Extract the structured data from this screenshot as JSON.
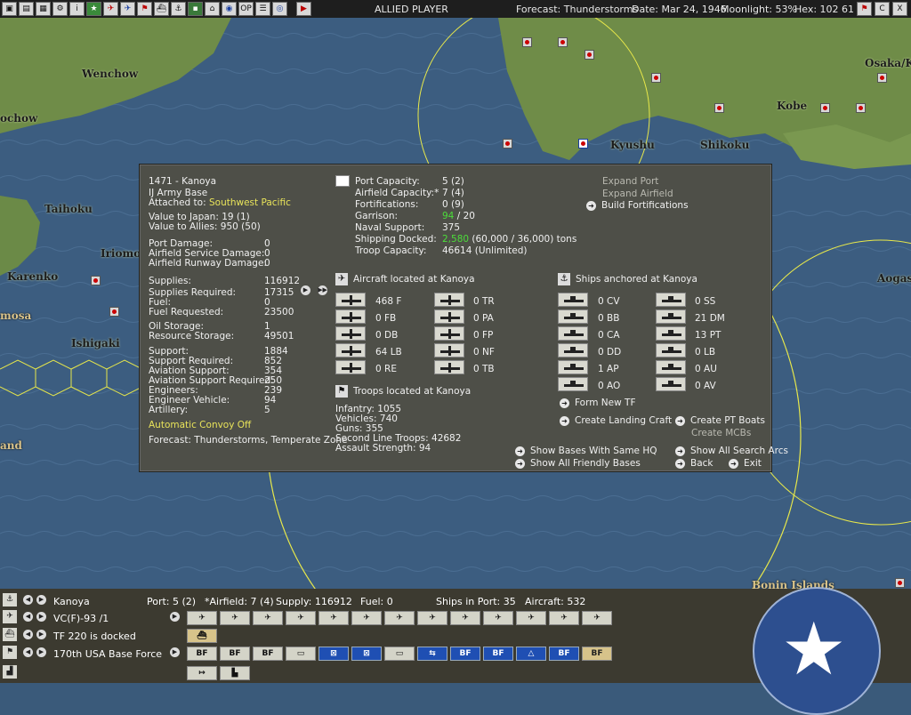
{
  "topbar": {
    "icons": [
      "save-icon",
      "document-icon",
      "map-icon",
      "gear-icon",
      "info-icon",
      "green-star-icon",
      "red-plane-icon",
      "blue-plane-icon",
      "flag-icon",
      "ship-icon",
      "anchor-icon",
      "tank-icon",
      "base-icon",
      "globe-icon",
      "op-icon",
      "list-icon",
      "target-icon",
      "play-icon"
    ],
    "op_label": "OP",
    "player": "ALLIED PLAYER",
    "forecast": "Forecast: Thunderstorms",
    "date": "Date: Mar 24, 1946",
    "moonlight": "Moonlight: 53%",
    "hex": "Hex: 102 61",
    "win_buttons": [
      "F",
      "C",
      "X"
    ]
  },
  "map_labels": {
    "wenchow": "Wenchow",
    "ochow": "ochow",
    "taihoku": "Taihoku",
    "iriomote": "Iriomot",
    "karenko": "Karenko",
    "mosa": "mosa",
    "ishigaki": "Ishigaki",
    "and": "and",
    "kyushu": "Kyushu",
    "shikoku": "Shikoku",
    "kobe": "Kobe",
    "osaka": "Osaka/K",
    "aogas": "Aogas",
    "bonin": "Bonin Islands"
  },
  "base_panel": {
    "title": "1471 - Kanoya",
    "type": "IJ Army Base",
    "attached_label": "Attached to:",
    "attached_value": "Southwest Pacific",
    "value_japan": "Value to Japan: 19 (1)",
    "value_allies": "Value to Allies: 950 (50)",
    "damage": [
      {
        "label": "Port Damage:",
        "value": "0"
      },
      {
        "label": "Airfield Service Damage:",
        "value": "0"
      },
      {
        "label": "Airfield Runway Damage:",
        "value": "0"
      }
    ],
    "supply": [
      {
        "label": "Supplies:",
        "value": "116912"
      },
      {
        "label": "Supplies Required:",
        "value": "17315"
      },
      {
        "label": "Fuel:",
        "value": "0"
      },
      {
        "label": "Fuel Requested:",
        "value": "23500"
      }
    ],
    "storage": [
      {
        "label": "Oil Storage:",
        "value": "1"
      },
      {
        "label": "Resource Storage:",
        "value": "49501"
      }
    ],
    "support": [
      {
        "label": "Support:",
        "value": "1884"
      },
      {
        "label": "Support Required:",
        "value": "852"
      },
      {
        "label": "Aviation Support:",
        "value": "354"
      },
      {
        "label": "Aviation Support Required:",
        "value": "250"
      },
      {
        "label": "Engineers:",
        "value": "239"
      },
      {
        "label": "Engineer Vehicle:",
        "value": "94"
      },
      {
        "label": "Artillery:",
        "value": "5"
      }
    ],
    "convoy": "Automatic Convoy Off",
    "forecast": "Forecast: Thunderstorms, Temperate Zone",
    "capacities": [
      {
        "label": "Port Capacity:",
        "value": "5 (2)"
      },
      {
        "label": "Airfield Capacity:*",
        "value": "7 (4)"
      },
      {
        "label": "Fortifications:",
        "value": "0 (9)"
      }
    ],
    "garrison_label": "Garrison:",
    "garrison_value": "94",
    "garrison_suffix": " / 20",
    "naval_support_label": "Naval Support:",
    "naval_support_value": "375",
    "shipping_label": "Shipping Docked:",
    "shipping_value": "2,580",
    "shipping_suffix": " (60,000 / 36,000) tons",
    "troop_label": "Troop Capacity:",
    "troop_value": "46614   (Unlimited)",
    "expand_port": "Expand Port",
    "expand_airfield": "Expand Airfield",
    "build_fort": "Build Fortifications",
    "aircraft_header": "Aircraft located at Kanoya",
    "aircraft_left": [
      "468 F",
      "0 FB",
      "0 DB",
      "64 LB",
      "0 RE"
    ],
    "aircraft_right": [
      "0 TR",
      "0 PA",
      "0 FP",
      "0 NF",
      "0 TB"
    ],
    "ships_header": "Ships anchored at Kanoya",
    "ships_left": [
      "0 CV",
      "0 BB",
      "0 CA",
      "0 DD",
      "1 AP",
      "0 AO"
    ],
    "ships_right": [
      "0 SS",
      "21 DM",
      "13 PT",
      "0 LB",
      "0 AU",
      "0 AV"
    ],
    "form_tf": "Form New TF",
    "create_landing": "Create Landing Craft",
    "create_pt": "Create PT Boats",
    "create_mcb": "Create MCBs",
    "troops_header": "Troops located at Kanoya",
    "troops": [
      "Infantry: 1055",
      "Vehicles: 740",
      "Guns: 355",
      "Second Line Troops: 42682",
      "Assault Strength: 94"
    ],
    "show_same_hq": "Show Bases With Same HQ",
    "show_friendly": "Show All Friendly Bases",
    "show_arcs": "Show All Search Arcs",
    "back": "Back",
    "exit": "Exit"
  },
  "bottom": {
    "base_name": "Kanoya",
    "port": "Port: 5 (2)",
    "airfield": "*Airfield: 7 (4)",
    "supply": "Supply: 116912",
    "fuel": "Fuel: 0",
    "ships_in_port": "Ships in Port: 35",
    "aircraft": "Aircraft: 532",
    "air_unit": "VC(F)-93 /1",
    "tf": "TF 220 is docked",
    "land_unit": "170th USA Base Force",
    "bf_slots": [
      "BF",
      "BF",
      "BF",
      "",
      "",
      "",
      "",
      "",
      "BF",
      "BF",
      "",
      "BF",
      "BF"
    ]
  }
}
